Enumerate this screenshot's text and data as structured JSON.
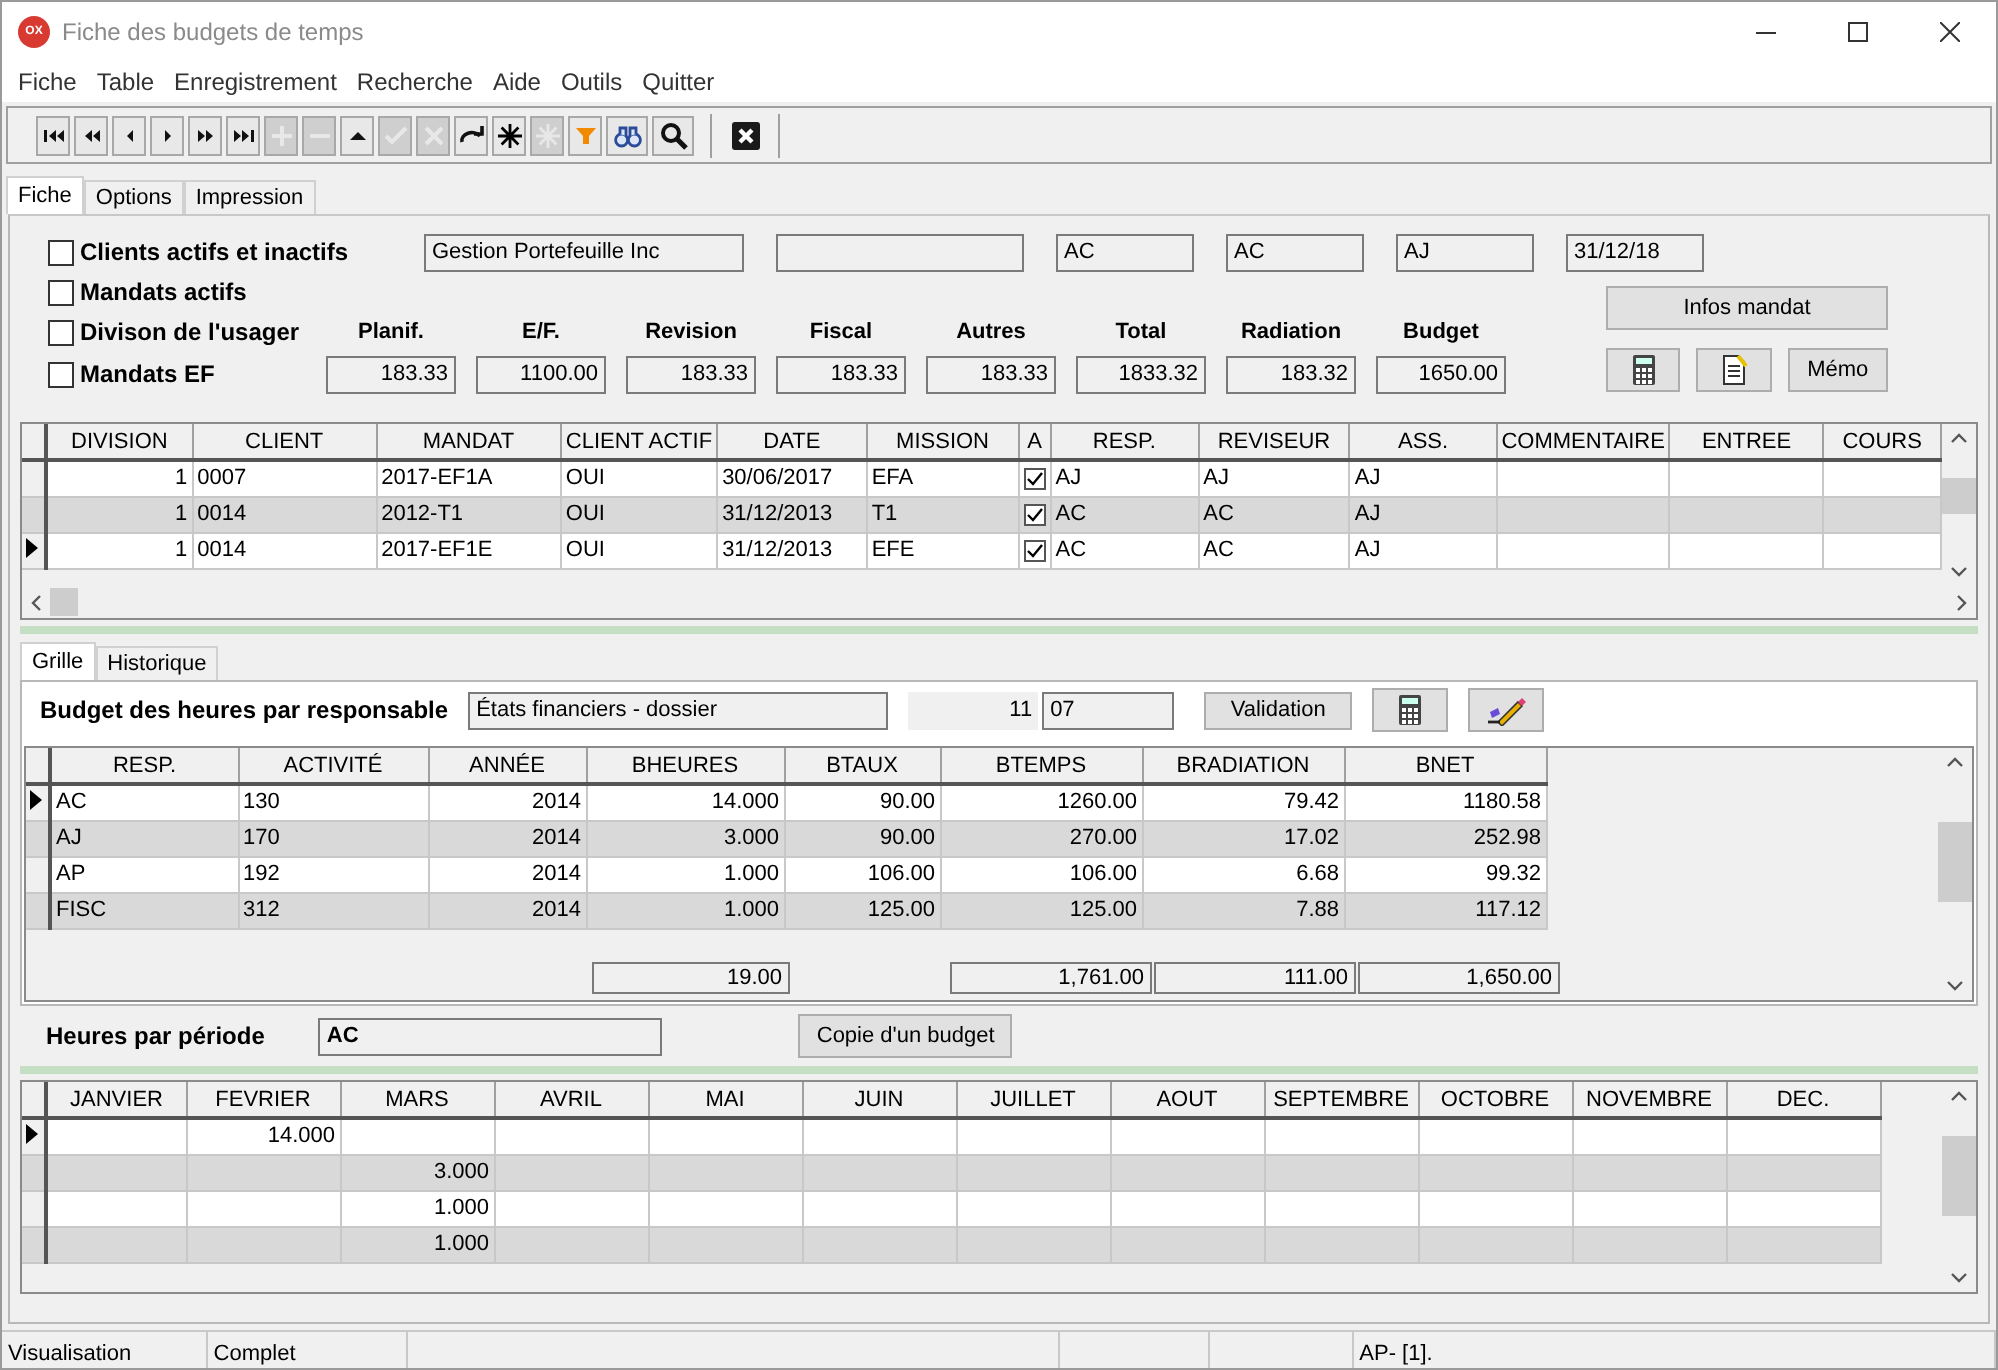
{
  "window": {
    "title": "Fiche des budgets de temps",
    "icon_label": "OX"
  },
  "menu": [
    "Fiche",
    "Table",
    "Enregistrement",
    "Recherche",
    "Aide",
    "Outils",
    "Quitter"
  ],
  "toolbar": [
    {
      "kind": "first",
      "disabled": false
    },
    {
      "kind": "prev-page",
      "disabled": false
    },
    {
      "kind": "prev",
      "disabled": false
    },
    {
      "kind": "next",
      "disabled": false
    },
    {
      "kind": "next-page",
      "disabled": false
    },
    {
      "kind": "last",
      "disabled": false
    },
    {
      "kind": "add",
      "disabled": true
    },
    {
      "kind": "remove",
      "disabled": true
    },
    {
      "kind": "up",
      "disabled": false
    },
    {
      "kind": "confirm",
      "disabled": true
    },
    {
      "kind": "cancel",
      "disabled": true
    },
    {
      "kind": "redo",
      "disabled": false
    },
    {
      "kind": "asterisk",
      "disabled": false
    },
    {
      "kind": "asterisk",
      "disabled": true
    },
    {
      "kind": "filter",
      "disabled": false
    },
    {
      "kind": "binoculars",
      "disabled": false
    },
    {
      "kind": "search",
      "disabled": false
    },
    {
      "kind": "close",
      "disabled": false
    }
  ],
  "tabs": [
    {
      "label": "Fiche",
      "selected": true
    },
    {
      "label": "Options",
      "selected": false
    },
    {
      "label": "Impression",
      "selected": false
    }
  ],
  "filters": [
    {
      "label": "Clients actifs et inactifs",
      "checked": false
    },
    {
      "label": "Mandats actifs",
      "checked": false
    },
    {
      "label": "Divison de l'usager",
      "checked": false
    },
    {
      "label": "Mandats EF",
      "checked": false
    }
  ],
  "header_fields": [
    {
      "kind": "text",
      "value": "Gestion Portefeuille Inc"
    },
    {
      "kind": "blank"
    },
    {
      "kind": "text",
      "value": "AC"
    },
    {
      "kind": "text",
      "value": "AC"
    },
    {
      "kind": "text",
      "value": "AJ"
    },
    {
      "kind": "text",
      "value": "31/12/18"
    }
  ],
  "totals": [
    {
      "label": "Planif.",
      "value": "183.33"
    },
    {
      "label": "E/F.",
      "value": "1100.00"
    },
    {
      "label": "Revision",
      "value": "183.33"
    },
    {
      "label": "Fiscal",
      "value": "183.33"
    },
    {
      "label": "Autres",
      "value": "183.33"
    },
    {
      "label": "Total",
      "value": "1833.32"
    },
    {
      "label": "Radiation",
      "value": "183.32"
    },
    {
      "label": "Budget",
      "value": "1650.00"
    }
  ],
  "mandate_buttons": {
    "info": "Infos mandat",
    "memo": "Mémo"
  },
  "mandates": {
    "columns": [
      "DIVISION",
      "CLIENT",
      "MANDAT",
      "CLIENT ACTIF",
      "DATE",
      "MISSION",
      "A",
      "RESP.",
      "REVISEUR",
      "ASS.",
      "COMMENTAIRE",
      "ENTREE",
      "COURS"
    ],
    "rows": [
      {
        "current": false,
        "a_checked": true,
        "cells": [
          "1",
          "0007",
          "2017-EF1A",
          "OUI",
          "30/06/2017",
          "EFA",
          "",
          "AJ",
          "AJ",
          "AJ",
          "",
          "",
          ""
        ]
      },
      {
        "current": false,
        "a_checked": true,
        "cells": [
          "1",
          "0014",
          "2012-T1",
          "OUI",
          "31/12/2013",
          "T1",
          "",
          "AC",
          "AC",
          "AJ",
          "",
          "",
          ""
        ]
      },
      {
        "current": true,
        "a_checked": true,
        "cells": [
          "1",
          "0014",
          "2017-EF1E",
          "OUI",
          "31/12/2013",
          "EFE",
          "",
          "AC",
          "AC",
          "AJ",
          "",
          "",
          ""
        ]
      }
    ]
  },
  "sub_tabs": [
    {
      "label": "Grille",
      "selected": true
    },
    {
      "label": "Historique",
      "selected": false
    }
  ],
  "budget": {
    "label": "Budget des heures par responsable",
    "mission": "États financiers - dossier",
    "number": "11",
    "code": "07",
    "validate": "Validation",
    "columns": [
      "RESP.",
      "ACTIVITÉ",
      "ANNÉE",
      "BHEURES",
      "BTAUX",
      "BTEMPS",
      "BRADIATION",
      "BNET"
    ],
    "rows": [
      {
        "current": true,
        "cells": [
          "AC",
          "130",
          "2014",
          "14.000",
          "90.00",
          "1260.00",
          "79.42",
          "1180.58"
        ]
      },
      {
        "current": false,
        "cells": [
          "AJ",
          "170",
          "2014",
          "3.000",
          "90.00",
          "270.00",
          "17.02",
          "252.98"
        ]
      },
      {
        "current": false,
        "cells": [
          "AP",
          "192",
          "2014",
          "1.000",
          "106.00",
          "106.00",
          "6.68",
          "99.32"
        ]
      },
      {
        "current": false,
        "cells": [
          "FISC",
          "312",
          "2014",
          "1.000",
          "125.00",
          "125.00",
          "7.88",
          "117.12"
        ]
      }
    ],
    "totals": [
      {
        "kind": "blank"
      },
      {
        "kind": "blank"
      },
      {
        "kind": "blank"
      },
      {
        "kind": "field",
        "value": "19.00"
      },
      {
        "kind": "blank"
      },
      {
        "kind": "field",
        "value": "1,761.00"
      },
      {
        "kind": "field",
        "value": "111.00"
      },
      {
        "kind": "field",
        "value": "1,650.00"
      }
    ]
  },
  "period": {
    "label": "Heures par période",
    "resp": "AC",
    "copy": "Copie d'un budget",
    "columns": [
      "JANVIER",
      "FEVRIER",
      "MARS",
      "AVRIL",
      "MAI",
      "JUIN",
      "JUILLET",
      "AOUT",
      "SEPTEMBRE",
      "OCTOBRE",
      "NOVEMBRE",
      "DEC."
    ],
    "rows": [
      {
        "current": true,
        "cells": [
          "",
          "14.000",
          "",
          "",
          "",
          "",
          "",
          "",
          "",
          "",
          "",
          ""
        ]
      },
      {
        "current": false,
        "cells": [
          "",
          "",
          "3.000",
          "",
          "",
          "",
          "",
          "",
          "",
          "",
          "",
          ""
        ]
      },
      {
        "current": false,
        "cells": [
          "",
          "",
          "1.000",
          "",
          "",
          "",
          "",
          "",
          "",
          "",
          "",
          ""
        ]
      },
      {
        "current": false,
        "cells": [
          "",
          "",
          "1.000",
          "",
          "",
          "",
          "",
          "",
          "",
          "",
          "",
          ""
        ]
      }
    ]
  },
  "status_bar": [
    {
      "kind": "text",
      "text": "Visualisation"
    },
    {
      "kind": "text",
      "text": "Complet"
    },
    {
      "kind": "blank"
    },
    {
      "kind": "blank"
    },
    {
      "kind": "blank"
    },
    {
      "kind": "text",
      "text": "AP- [1]."
    }
  ]
}
